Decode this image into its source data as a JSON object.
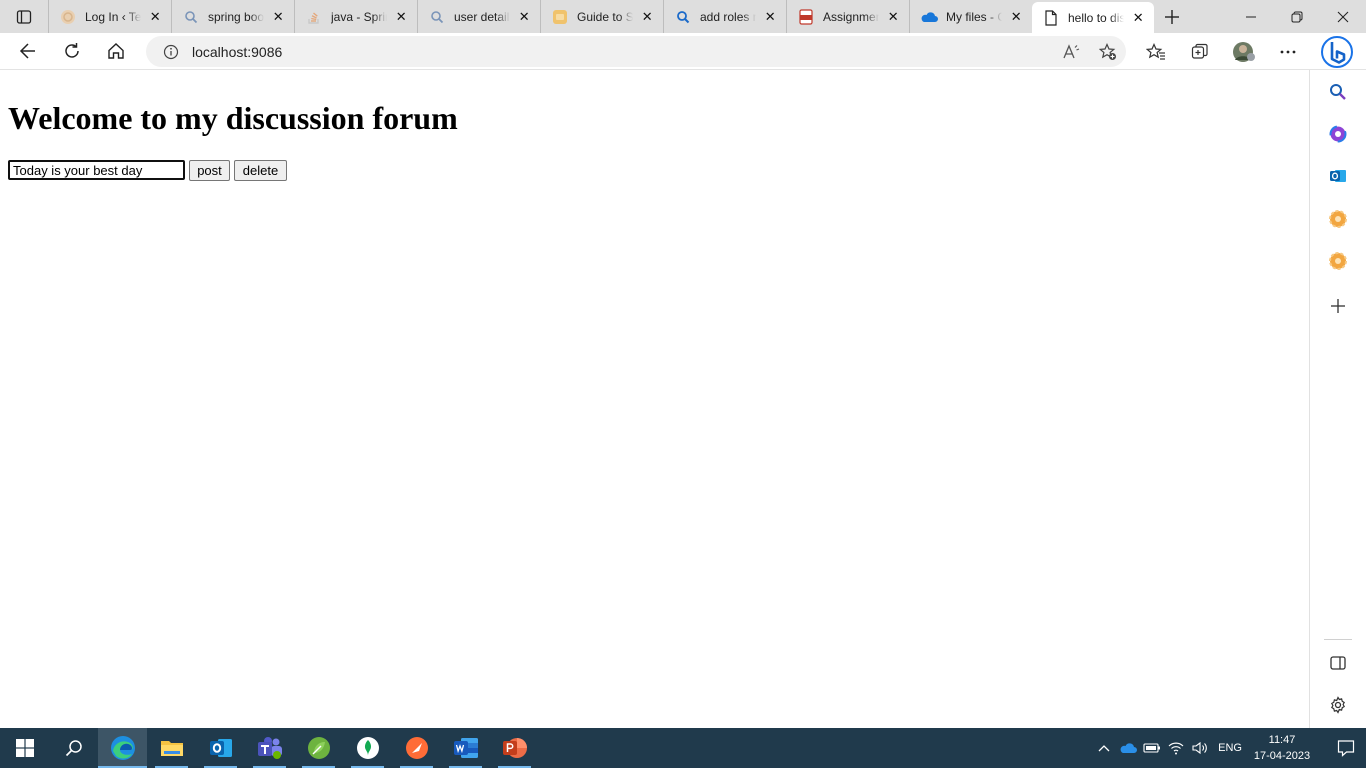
{
  "browser": {
    "tabs": [
      {
        "title": "Log In ‹ Te",
        "icon": "wordpress-icon",
        "active": false
      },
      {
        "title": "spring boo",
        "icon": "search-icon",
        "active": false
      },
      {
        "title": "java - Sprin",
        "icon": "stackoverflow-icon",
        "active": false
      },
      {
        "title": "user details",
        "icon": "search-icon",
        "active": false
      },
      {
        "title": "Guide to Sp",
        "icon": "baeldung-icon",
        "active": false
      },
      {
        "title": "add roles n",
        "icon": "search-icon",
        "active": false
      },
      {
        "title": "Assignmen",
        "icon": "pdf-icon",
        "active": false
      },
      {
        "title": "My files - C",
        "icon": "onedrive-icon",
        "active": false
      },
      {
        "title": "hello to dis",
        "icon": "page-icon",
        "active": true
      }
    ],
    "address_bar": {
      "url": "localhost:9086"
    },
    "accent_color": "#0078d4"
  },
  "page": {
    "heading": "Welcome to my discussion forum",
    "message_input_value": "Today is your best day",
    "post_label": "post",
    "delete_label": "delete"
  },
  "sidebar": {
    "items": [
      "search-icon",
      "copilot-icon",
      "outlook-icon",
      "extension-icon",
      "extension-icon",
      "add-icon",
      "split-screen-icon",
      "settings-icon"
    ]
  },
  "taskbar": {
    "apps": [
      "start-icon",
      "search-icon",
      "edge-icon",
      "file-explorer-icon",
      "outlook-icon",
      "teams-icon",
      "spring-tool-suite-icon",
      "mongodb-compass-icon",
      "postman-icon",
      "word-icon",
      "powerpoint-icon"
    ],
    "language": "ENG",
    "time": "11:47",
    "date": "17-04-2023"
  }
}
